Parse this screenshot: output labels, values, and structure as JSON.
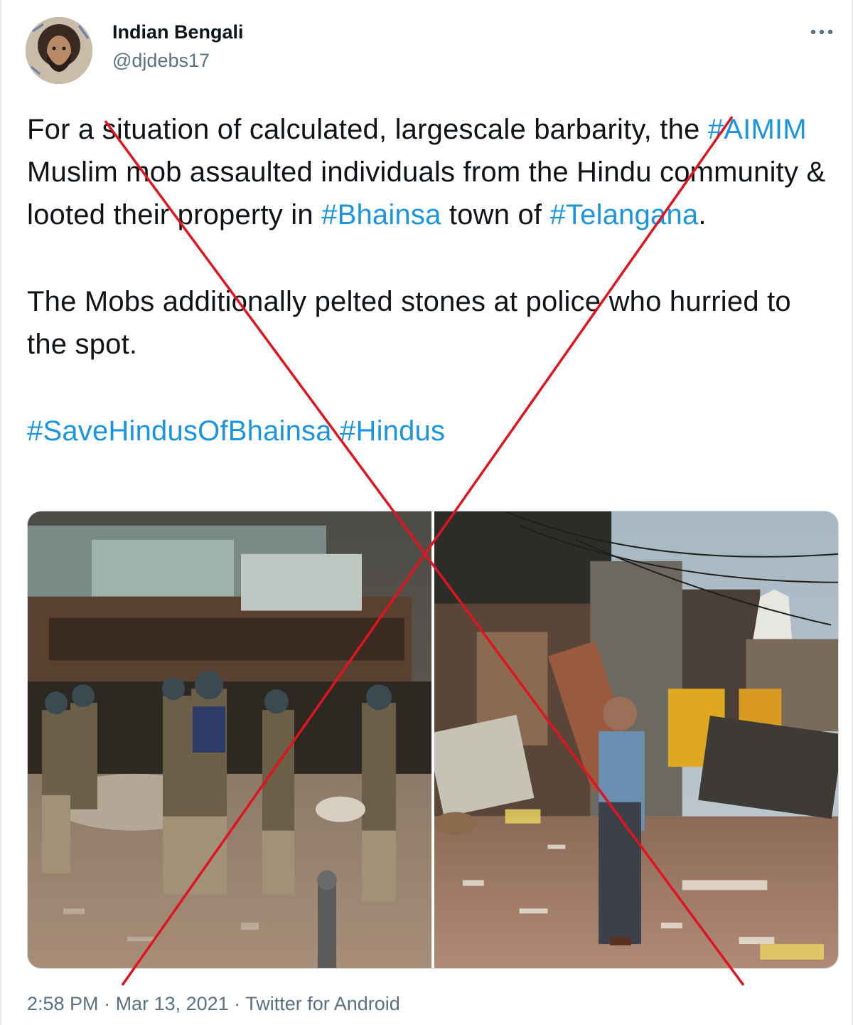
{
  "author": {
    "display_name": "Indian Bengali",
    "handle": "@djdebs17"
  },
  "tweet": {
    "p1": [
      {
        "text": "For a situation of calculated, largescale barbarity, the ",
        "type": "text"
      },
      {
        "text": "#AIMIM",
        "type": "hashtag"
      },
      {
        "text": " Muslim mob assaulted individuals from the Hindu community & looted their property in ",
        "type": "text"
      },
      {
        "text": "#Bhainsa",
        "type": "hashtag"
      },
      {
        "text": " town of ",
        "type": "text"
      },
      {
        "text": "#Telangana",
        "type": "hashtag"
      },
      {
        "text": ".",
        "type": "text"
      }
    ],
    "p2": "The Mobs additionally pelted stones at police who hurried to the spot.",
    "p3_hashtags": [
      "#SaveHindusOfBhainsa",
      "#Hindus"
    ]
  },
  "meta": {
    "time": "2:58 PM",
    "date": "Mar 13, 2021",
    "source": "Twitter for Android",
    "separator": " · "
  },
  "overlay": {
    "cross_color": "#e0141e"
  },
  "colors": {
    "hashtag": "#1b95e0",
    "muted": "#5b7083",
    "text": "#0f1419"
  }
}
